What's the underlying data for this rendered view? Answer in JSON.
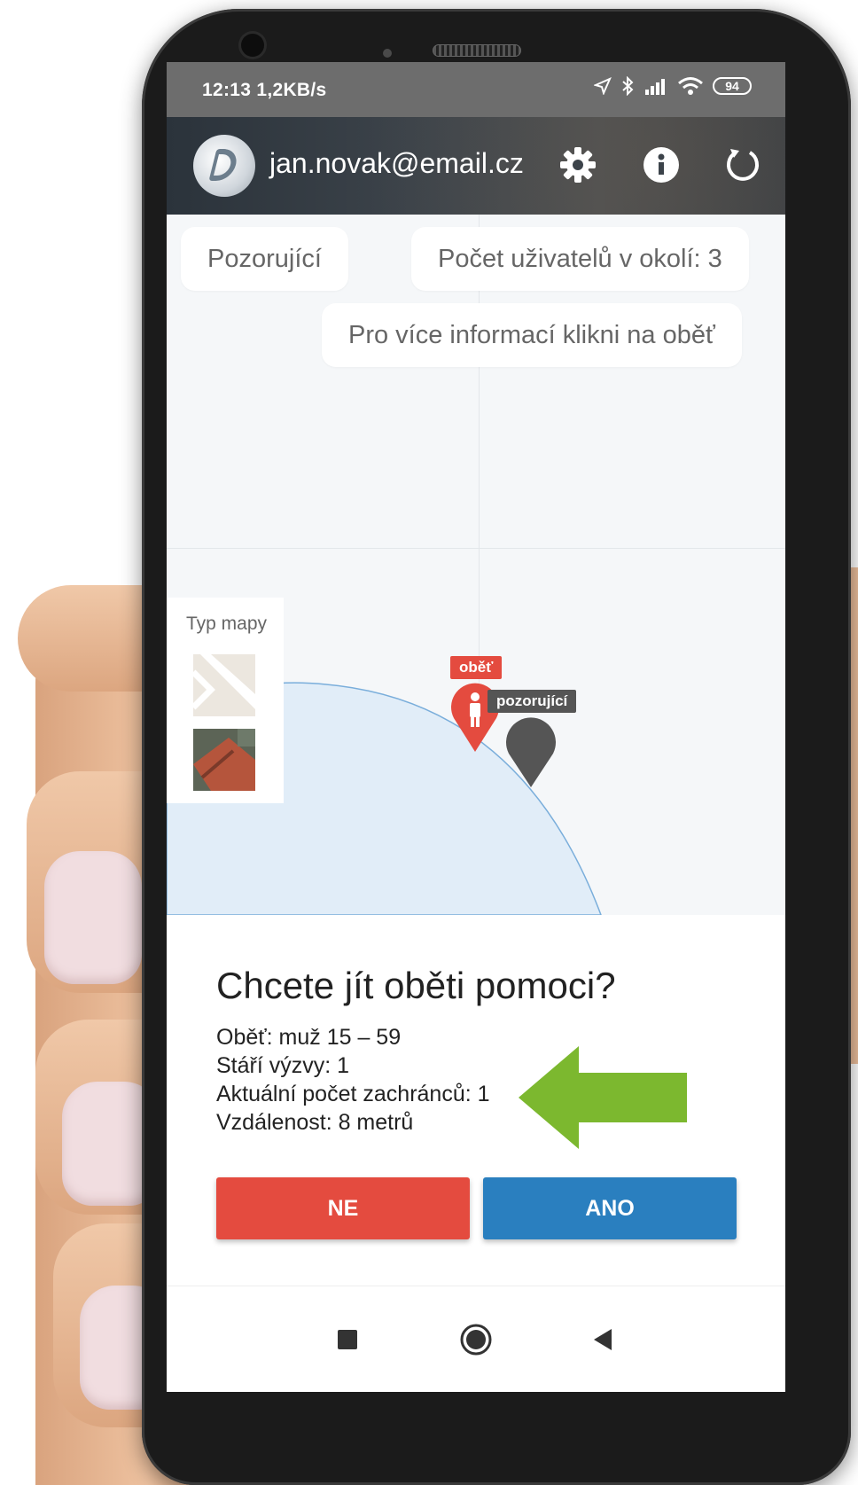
{
  "status_bar": {
    "time": "12:13",
    "net_speed": "1,2KB/s",
    "battery": "94"
  },
  "app_bar": {
    "email": "jan.novak@email.cz",
    "icons": [
      "settings-icon",
      "info-icon",
      "refresh-icon"
    ]
  },
  "map": {
    "role_chip": "Pozorující",
    "users_nearby": "Počet uživatelů v okolí: 3",
    "hint": "Pro více informací klikni na oběť",
    "map_type_label": "Typ mapy",
    "victim_label": "oběť",
    "observer_label": "pozorující"
  },
  "dialog": {
    "title": "Chcete jít oběti pomoci?",
    "victim": "Oběť: muž 15 – 59",
    "age": "Stáří výzvy: 1",
    "rescuers": "Aktuální počet zachránců: 1",
    "distance": "Vzdálenost: 8 metrů",
    "no_label": "NE",
    "yes_label": "ANO"
  },
  "colors": {
    "victim": "#e44b3f",
    "observer": "#555555",
    "accent_blue": "#2a7fbf",
    "arrow": "#7cb82f"
  }
}
